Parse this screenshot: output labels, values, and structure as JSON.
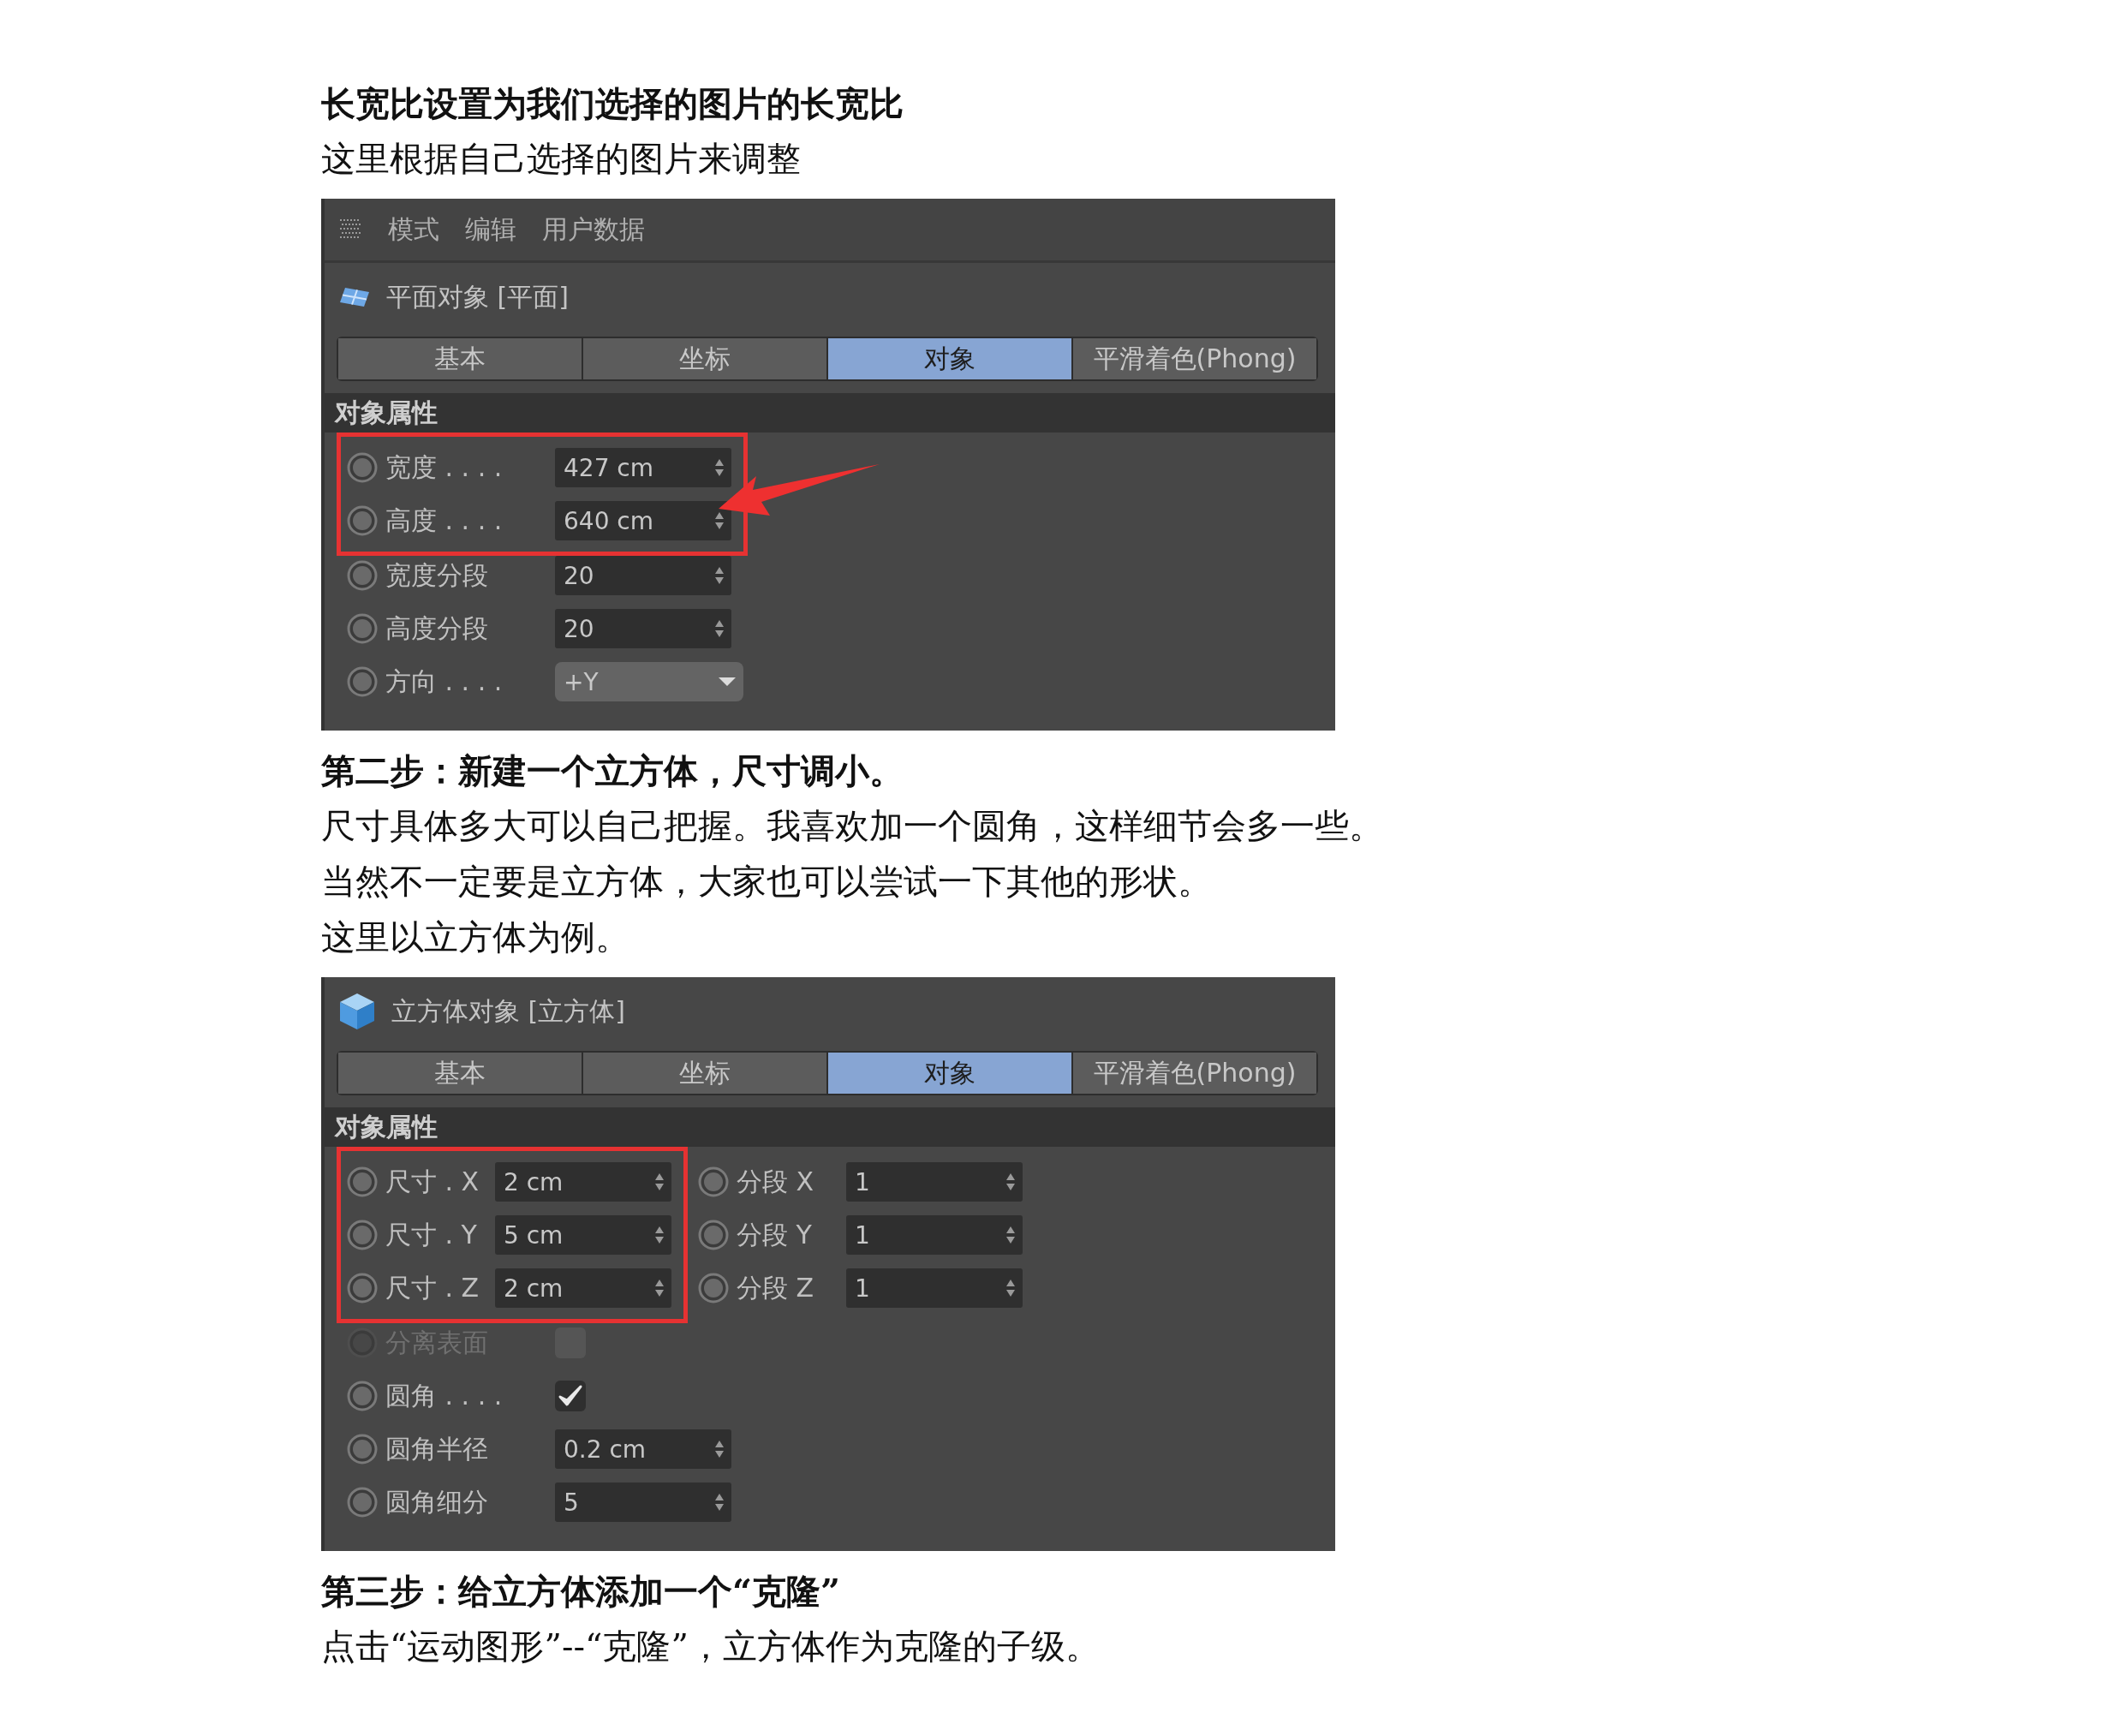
{
  "sections": [
    {
      "kind": "heading",
      "text": "长宽比设置为我们选择的图片的长宽比"
    },
    {
      "kind": "text",
      "text": "这里根据自己选择的图片来调整"
    },
    {
      "kind": "panel",
      "menu": [
        "模式",
        "编辑",
        "用户数据"
      ],
      "object": {
        "kind": "plane",
        "title": "平面对象 [平面]"
      },
      "tabs": [
        {
          "label": "基本",
          "selected": false
        },
        {
          "label": "坐标",
          "selected": false
        },
        {
          "label": "对象",
          "selected": true
        },
        {
          "label": "平滑着色(Phong)",
          "selected": false
        }
      ],
      "header": "对象属性",
      "arrow": true,
      "groups": [
        {
          "columns": [
            {
              "highlighted": true,
              "rows": [
                {
                  "kind": "number",
                  "label": "宽度 . . . .",
                  "value": "427 cm"
                },
                {
                  "kind": "number",
                  "label": "高度 . . . .",
                  "value": "640 cm"
                }
              ]
            }
          ]
        },
        {
          "columns": [
            {
              "highlighted": false,
              "rows": [
                {
                  "kind": "number",
                  "label": "宽度分段",
                  "value": "20"
                },
                {
                  "kind": "number",
                  "label": "高度分段",
                  "value": "20"
                },
                {
                  "kind": "dropdown",
                  "label": "方向 . . . .",
                  "value": "+Y"
                }
              ]
            }
          ]
        }
      ]
    },
    {
      "kind": "heading",
      "text": "第二步：新建一个立方体，尺寸调小。"
    },
    {
      "kind": "text",
      "text": "尺寸具体多大可以自己把握。我喜欢加一个圆角，这样细节会多一些。"
    },
    {
      "kind": "text",
      "text": "当然不一定要是立方体，大家也可以尝试一下其他的形状。"
    },
    {
      "kind": "text",
      "text": "这里以立方体为例。"
    },
    {
      "kind": "panel",
      "object": {
        "kind": "cube",
        "title": "立方体对象 [立方体]"
      },
      "tabs": [
        {
          "label": "基本",
          "selected": false
        },
        {
          "label": "坐标",
          "selected": false
        },
        {
          "label": "对象",
          "selected": true
        },
        {
          "label": "平滑着色(Phong)",
          "selected": false
        }
      ],
      "header": "对象属性",
      "groups": [
        {
          "columns": [
            {
              "highlighted": true,
              "rows": [
                {
                  "kind": "number",
                  "label": "尺寸 . X",
                  "value": "2 cm"
                },
                {
                  "kind": "number",
                  "label": "尺寸 . Y",
                  "value": "5 cm"
                },
                {
                  "kind": "number",
                  "label": "尺寸 . Z",
                  "value": "2 cm"
                }
              ]
            },
            {
              "highlighted": false,
              "rows": [
                {
                  "kind": "number",
                  "label": "分段 X",
                  "value": "1"
                },
                {
                  "kind": "number",
                  "label": "分段 Y",
                  "value": "1"
                },
                {
                  "kind": "number",
                  "label": "分段 Z",
                  "value": "1"
                }
              ]
            }
          ]
        },
        {
          "columns": [
            {
              "highlighted": false,
              "rows": [
                {
                  "kind": "checkbox",
                  "label": "分离表面",
                  "checked": false,
                  "disabled": true
                },
                {
                  "kind": "checkbox",
                  "label": "圆角 . . . .",
                  "checked": true,
                  "disabled": false
                },
                {
                  "kind": "number",
                  "label": "圆角半径",
                  "value": "0.2 cm"
                },
                {
                  "kind": "number",
                  "label": "圆角细分",
                  "value": "5"
                }
              ]
            }
          ]
        }
      ]
    },
    {
      "kind": "heading",
      "text": "第三步：给立方体添加一个“克隆”"
    },
    {
      "kind": "text",
      "text": "点击“运动图形”--“克隆”，立方体作为克隆的子级。"
    }
  ]
}
